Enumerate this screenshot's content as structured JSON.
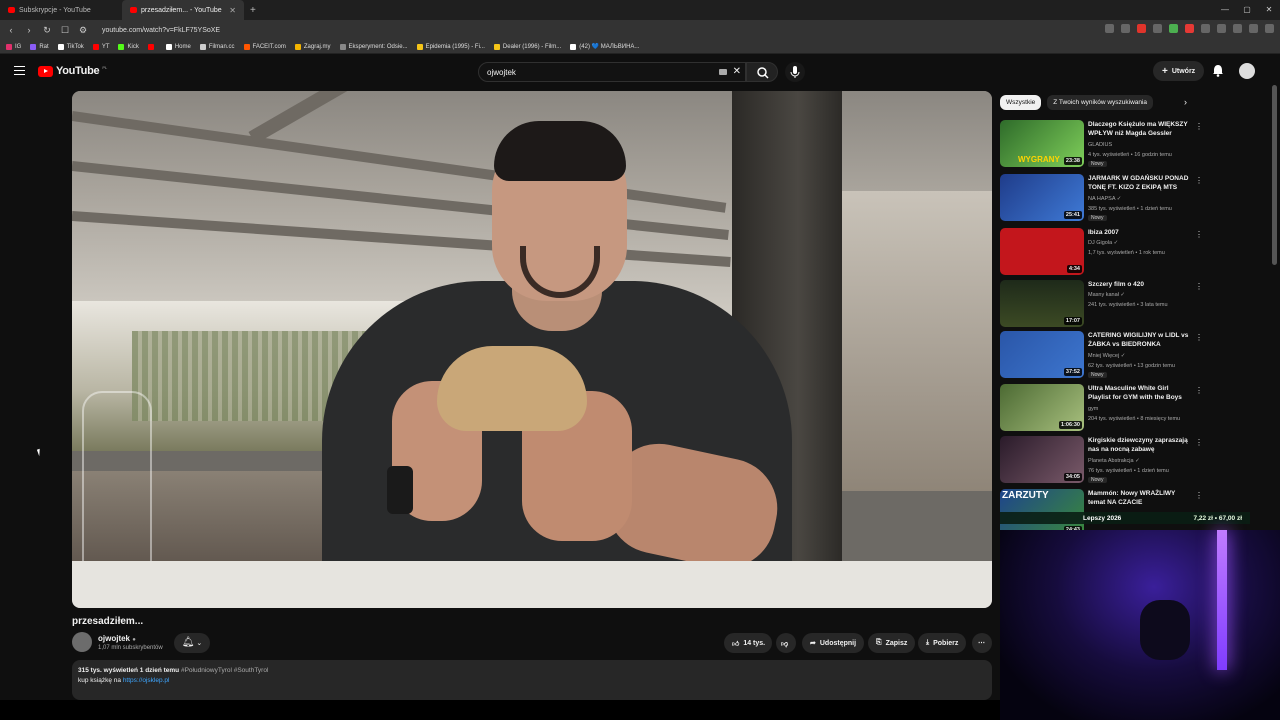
{
  "browser": {
    "tabs": [
      {
        "title": "Subskrypcje - YouTube",
        "active": false
      },
      {
        "title": "przesadziłem... - YouTube",
        "active": true
      }
    ],
    "url": "youtube.com/watch?v=FkLF75YSoXE",
    "bookmarks": [
      {
        "label": "IG",
        "color": "#e1306c"
      },
      {
        "label": "Rat",
        "color": "#8a5cf6"
      },
      {
        "label": "TikTok",
        "color": "#ffffff"
      },
      {
        "label": "YT",
        "color": "#ff0000"
      },
      {
        "label": "Kick",
        "color": "#53fc18"
      },
      {
        "label": "",
        "color": "#ff0000"
      },
      {
        "label": "Home",
        "color": "#ffffff"
      },
      {
        "label": "Filman.cc",
        "color": "#cccccc"
      },
      {
        "label": "FACEIT.com",
        "color": "#ff5500"
      },
      {
        "label": "Zagraj.my",
        "color": "#f4b400"
      },
      {
        "label": "Eksperyment: Odsie...",
        "color": "#888888"
      },
      {
        "label": "Epidemia (1995) - Fi...",
        "color": "#f5c518"
      },
      {
        "label": "Dealer (1996) - Film...",
        "color": "#f5c518"
      },
      {
        "label": "(42) 💙 МАЛЬВИНА...",
        "color": "#ffffff"
      }
    ]
  },
  "header": {
    "logo_text": "YouTube",
    "logo_region": "PL",
    "search_value": "ojwojtek",
    "create_label": "Utwórz"
  },
  "video": {
    "title": "przesadziłem...",
    "channel": "ojwojtek",
    "subscribers": "1,07 mln subskrybentów",
    "likes": "14 tys.",
    "share_label": "Udostępnij",
    "save_label": "Zapisz",
    "download_label": "Pobierz",
    "description": {
      "views_date": "315 tys. wyświetleń  1 dzień temu",
      "tags": "#PołudniowyTyrol #SouthTyrol",
      "line2_prefix": "kup książkę na",
      "link": "https://ojsklep.pl"
    }
  },
  "sidebar": {
    "chips": [
      "Wszystkie",
      "Z Twoich wyników wyszukiwania"
    ],
    "recommendations": [
      {
        "title": "Dlaczego Księżulo ma WIĘKSZY WPŁYW niż Magda Gessler",
        "channel": "GLADIUS",
        "meta": "4 tys. wyświetleń • 16 godzin temu",
        "badge": "Nowy",
        "duration": "23:38",
        "thumb": "#3f7a3a"
      },
      {
        "title": "JARMARK W GDAŃSKU PONAD TONĘ FT. KIZO Z EKIPĄ MTS",
        "channel": "NA HAPSA ✓",
        "meta": "385 tys. wyświetleń • 1 dzień temu",
        "badge": "Nowy",
        "duration": "25:41",
        "thumb": "#2c4fa3"
      },
      {
        "title": "Ibiza 2007",
        "channel": "DJ Gigola ✓",
        "meta": "1,7 tys. wyświetleń • 1 rok temu",
        "badge": "",
        "duration": "4:34",
        "thumb": "#c3161c"
      },
      {
        "title": "Szczery film o 420",
        "channel": "Masny kanał ✓",
        "meta": "241 tys. wyświetleń • 3 lata temu",
        "badge": "",
        "duration": "17:07",
        "thumb": "#2f3a23"
      },
      {
        "title": "CATERING WIGILIJNY w LIDL vs ŻABKA vs BIEDRONKA",
        "channel": "Mniej Więcej ✓",
        "meta": "62 tys. wyświetleń • 13 godzin temu",
        "badge": "Nowy",
        "duration": "37:52",
        "thumb": "#2f63b8"
      },
      {
        "title": "Ultra Masculine White Girl Playlist for GYM with the Boys",
        "channel": "gym",
        "meta": "204 tys. wyświetleń • 8 miesięcy temu",
        "badge": "",
        "duration": "1:06:30",
        "thumb": "#6d7f4a"
      },
      {
        "title": "Kirgiskie dziewczyny zapraszają nas na nocną zabawę",
        "channel": "Planeta Abstrakcja ✓",
        "meta": "76 tys. wyświetleń • 1 dzień temu",
        "badge": "Nowy",
        "duration": "34:05",
        "thumb": "#4a2f44"
      },
      {
        "title": "Mammón: Nowy WRAŻLIWY temat NA CZACIE",
        "channel": "",
        "meta": "",
        "badge": "",
        "duration": "24:43",
        "thumb": "#2b58a0"
      }
    ]
  },
  "overlay": {
    "thumb_text_1": "WYGRANY",
    "thumb_text_2": "ZARZUTY",
    "banner_left": "Lepszy 2026",
    "banner_right": "7,22 zł • 67,00 zł"
  }
}
